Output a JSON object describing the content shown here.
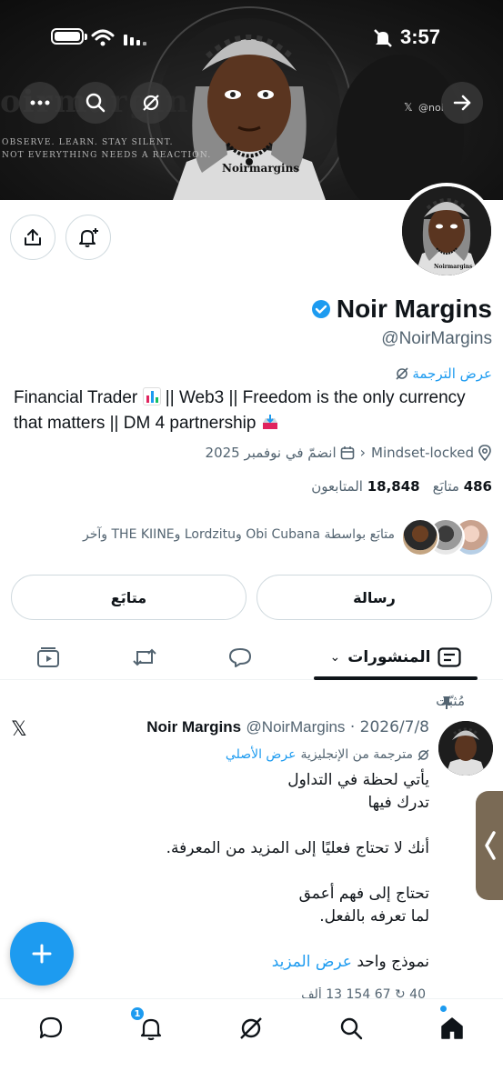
{
  "status_bar": {
    "time": "3:57"
  },
  "banner": {
    "tagline_line1": "OBSERVE. LEARN. STAY SILENT.",
    "tagline_line2": "NOT EVERYTHING NEEDS A REACTION.",
    "shirt_text": "Noirmargins",
    "handle": "@noi"
  },
  "profile": {
    "name": "Noir Margins",
    "handle": "@NoirMargins",
    "translate_label": "عرض الترجمة",
    "bio_part1": "Financial Trader",
    "bio_part2": "|| Web3 || Freedom is the only currency that matters || DM 4 partnership",
    "location": "Mindset-locked",
    "joined": "انضمّ في نوفمبر 2025",
    "following_count": "486",
    "following_label": "متابَع",
    "followers_count": "18,848",
    "followers_label": "المتابعون",
    "followed_by": "متابَع بواسطة Obi Cubana وLordzitu وTHE KIINE وآخر"
  },
  "buttons": {
    "message": "رسالة",
    "following": "متابَع"
  },
  "tabs": {
    "posts": "المنشورات"
  },
  "post": {
    "pinned_label": "مُثبّت",
    "author_name": "Noir Margins",
    "author_handle": "@NoirMargins",
    "date": "2026/7/8",
    "translated_from": "مترجمة من الإنجليزية",
    "show_original": "عرض الأصلي",
    "lines": [
      "يأتي لحظة في التداول",
      "تدرك فيها",
      "",
      "أنك لا تحتاج فعليًا إلى المزيد من المعرفة.",
      "",
      "تحتاج إلى فهم أعمق",
      "لما تعرفه بالفعل.",
      ""
    ],
    "last_line": "نموذج واحد",
    "show_more": "عرض المزيد",
    "stats_partial": "40   ↻ 67   154   13 ألف"
  },
  "nav": {
    "notifications_badge": "1"
  },
  "colors": {
    "accent": "#1d9bf0",
    "text": "#0f1419",
    "muted": "#536471",
    "border": "#cfd9de"
  }
}
